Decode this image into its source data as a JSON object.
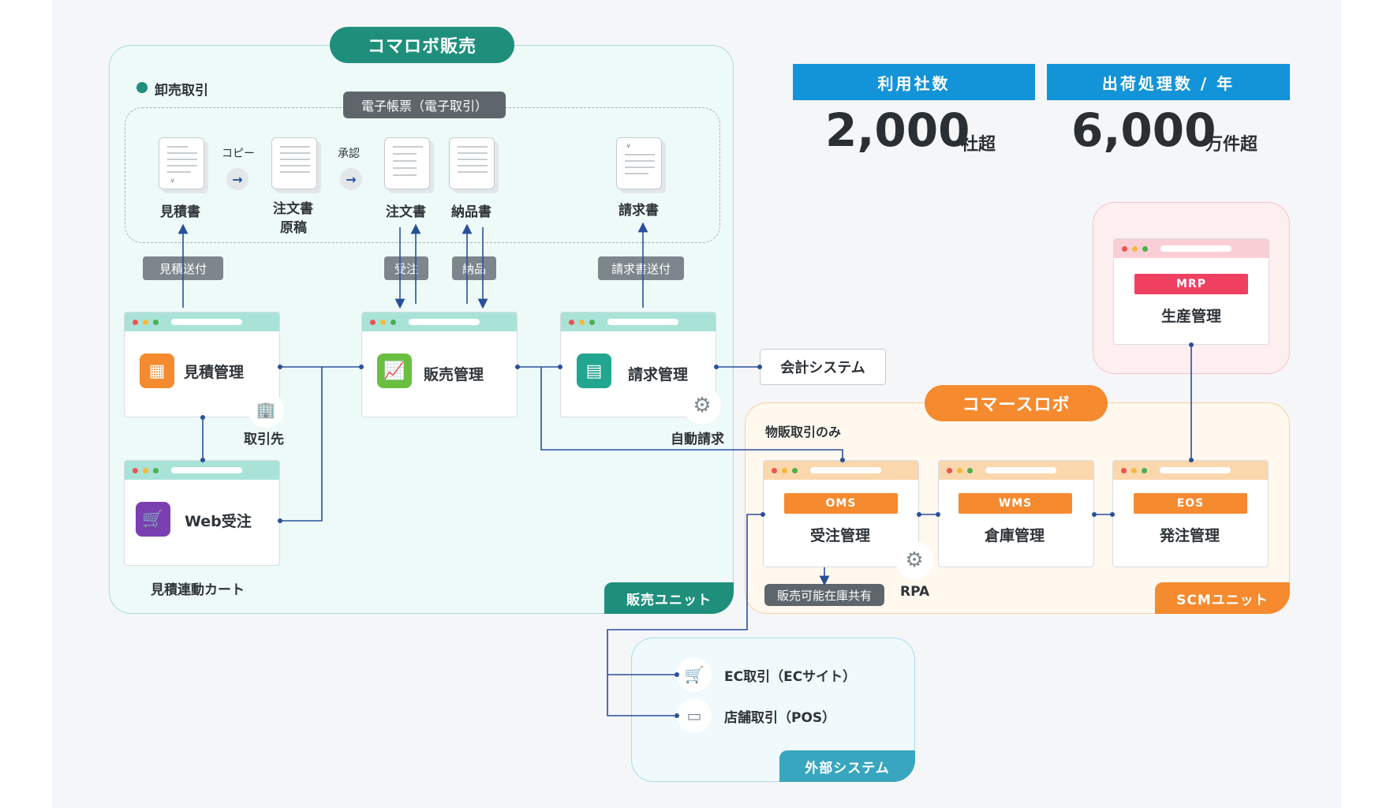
{
  "sales_unit": {
    "title": "コマロボ販売",
    "unit_tag": "販売ユニット",
    "wholesale_label": "卸売取引",
    "e_documents_tag": "電子帳票（電子取引）",
    "copy_label": "コピー",
    "approve_label": "承認",
    "docs": {
      "estimate": "見積書",
      "order_draft_1": "注文書",
      "order_draft_2": "原稿",
      "order": "注文書",
      "delivery": "納品書",
      "invoice": "請求書"
    },
    "flow_tags": {
      "send_estimate": "見積送付",
      "receive_order": "受注",
      "deliver": "納品",
      "send_invoice": "請求書送付"
    },
    "apps": {
      "estimate_mgmt": "見積管理",
      "web_order": "Web受注",
      "sales_mgmt": "販売管理",
      "billing_mgmt": "請求管理"
    },
    "partner_label": "取引先",
    "auto_billing_label": "自動請求",
    "cart_label": "見積連動カート"
  },
  "accounting_system": "会計システム",
  "commerce_robo": {
    "title": "コマースロボ",
    "physical_only": "物販取引のみ",
    "unit_tag": "SCMユニット",
    "modules": [
      {
        "code": "OMS",
        "name": "受注管理"
      },
      {
        "code": "WMS",
        "name": "倉庫管理"
      },
      {
        "code": "EOS",
        "name": "発注管理"
      }
    ],
    "inventory_share": "販売可能在庫共有",
    "rpa_label": "RPA"
  },
  "mrp": {
    "code": "MRP",
    "name": "生産管理"
  },
  "external": {
    "tag": "外部システム",
    "ec": "EC取引（ECサイト）",
    "pos": "店舗取引（POS）"
  },
  "stats": [
    {
      "label": "利用社数",
      "value": "2,000",
      "unit": "社超"
    },
    {
      "label": "出荷処理数 / 年",
      "value": "6,000",
      "unit": "万件超"
    }
  ],
  "colors": {
    "sales_green": "#1f8f7c",
    "commerce_orange": "#f58a2e",
    "external_blue": "#39a6bf",
    "stat_blue": "#1393d8",
    "mrp_red": "#ef4062",
    "line_blue": "#2a4f9a"
  }
}
